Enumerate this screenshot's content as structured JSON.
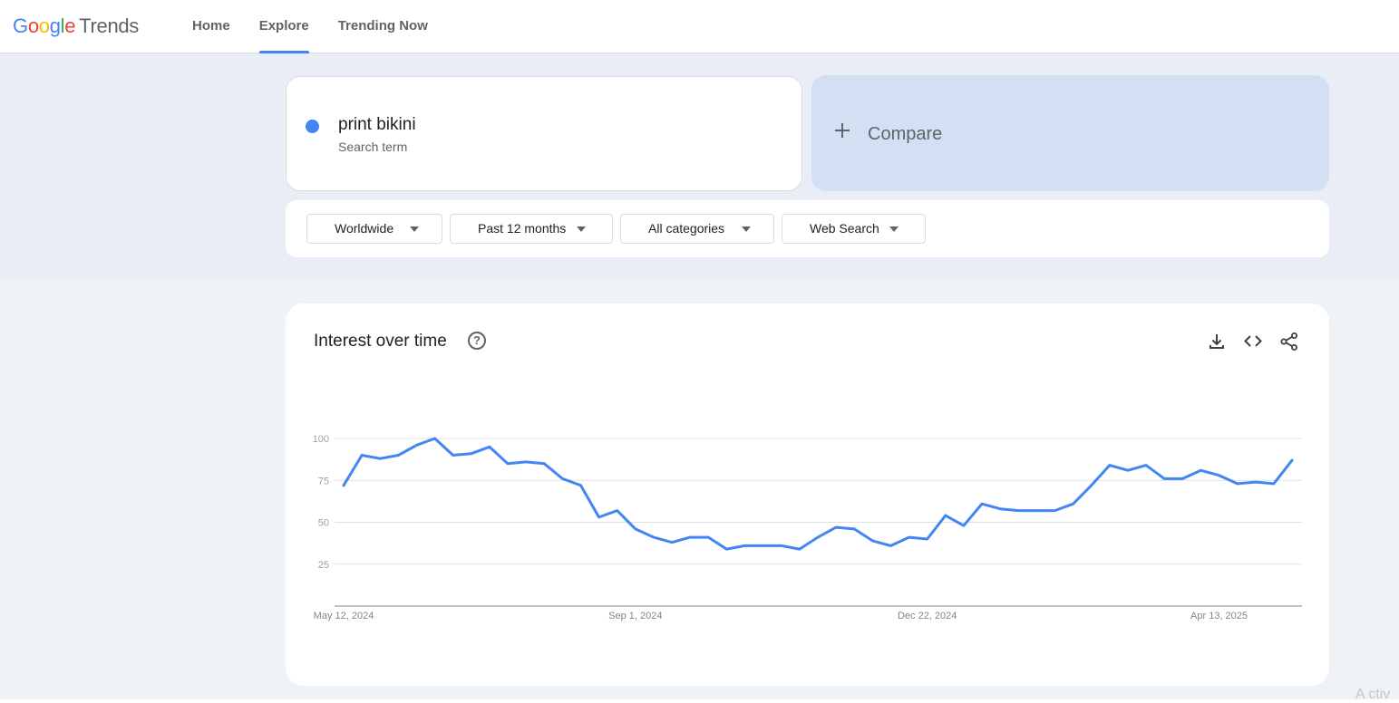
{
  "app": {
    "logo_letters": [
      {
        "char": "G",
        "color": "#4285f4"
      },
      {
        "char": "o",
        "color": "#ea4335"
      },
      {
        "char": "o",
        "color": "#fbbc04"
      },
      {
        "char": "g",
        "color": "#4285f4"
      },
      {
        "char": "l",
        "color": "#34a853"
      },
      {
        "char": "e",
        "color": "#ea4335"
      }
    ],
    "logo_suffix": "Trends"
  },
  "nav": {
    "tabs": [
      {
        "label": "Home",
        "active": false
      },
      {
        "label": "Explore",
        "active": true
      },
      {
        "label": "Trending Now",
        "active": false
      }
    ]
  },
  "search": {
    "term": "print bikini",
    "term_type": "Search term",
    "term_color": "#4285f4",
    "compare_label": "Compare",
    "compare_icon": "plus-icon"
  },
  "filters": {
    "region": "Worldwide",
    "time_range": "Past 12 months",
    "category": "All categories",
    "property": "Web Search"
  },
  "card": {
    "title": "Interest over time",
    "help_icon": "help-icon",
    "help_glyph": "?",
    "actions": [
      "download-icon",
      "embed-code-icon",
      "share-icon"
    ]
  },
  "chart_data": {
    "type": "line",
    "title": "Interest over time",
    "xlabel": "",
    "ylabel": "",
    "ylim": [
      0,
      100
    ],
    "yticks": [
      25,
      50,
      75,
      100
    ],
    "grid": true,
    "x_tick_labels": [
      {
        "label": "May 12, 2024",
        "week_index": 0
      },
      {
        "label": "Sep 1, 2024",
        "week_index": 16
      },
      {
        "label": "Dec 22, 2024",
        "week_index": 32
      },
      {
        "label": "Apr 13, 2025",
        "week_index": 48
      }
    ],
    "series": [
      {
        "name": "print bikini",
        "color": "#4285f4",
        "values": [
          72,
          90,
          88,
          90,
          96,
          100,
          90,
          91,
          95,
          85,
          86,
          85,
          76,
          72,
          53,
          57,
          46,
          41,
          38,
          41,
          41,
          34,
          36,
          36,
          36,
          34,
          41,
          47,
          46,
          39,
          36,
          41,
          40,
          54,
          48,
          61,
          58,
          57,
          57,
          57,
          61,
          72,
          84,
          81,
          84,
          76,
          76,
          81,
          78,
          73,
          74,
          73,
          87
        ]
      }
    ]
  },
  "corner_fragment": "A ctiv"
}
